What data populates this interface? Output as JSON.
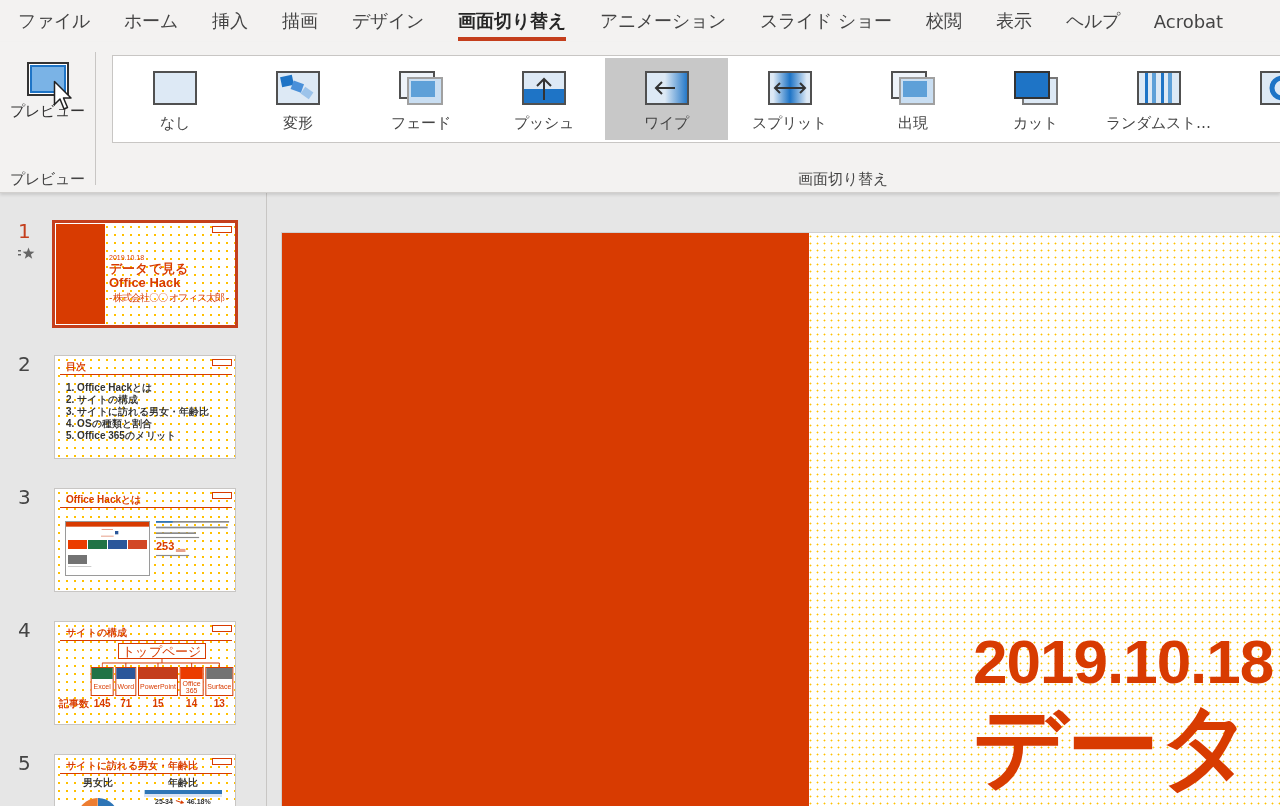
{
  "ribbon_tabs": [
    {
      "label": "ファイル",
      "selected": false
    },
    {
      "label": "ホーム",
      "selected": false
    },
    {
      "label": "挿入",
      "selected": false
    },
    {
      "label": "描画",
      "selected": false
    },
    {
      "label": "デザイン",
      "selected": false
    },
    {
      "label": "画面切り替え",
      "selected": true
    },
    {
      "label": "アニメーション",
      "selected": false
    },
    {
      "label": "スライド ショー",
      "selected": false
    },
    {
      "label": "校閲",
      "selected": false
    },
    {
      "label": "表示",
      "selected": false
    },
    {
      "label": "ヘルプ",
      "selected": false
    },
    {
      "label": "Acrobat",
      "selected": false
    }
  ],
  "ribbon": {
    "preview": {
      "button": "プレビュー",
      "group_label": "プレビュー"
    },
    "transitions": {
      "gallery": [
        {
          "label": "なし",
          "selected": false
        },
        {
          "label": "変形",
          "selected": false
        },
        {
          "label": "フェード",
          "selected": false
        },
        {
          "label": "プッシュ",
          "selected": false
        },
        {
          "label": "ワイプ",
          "selected": true
        },
        {
          "label": "スプリット",
          "selected": false
        },
        {
          "label": "出現",
          "selected": false
        },
        {
          "label": "カット",
          "selected": false
        },
        {
          "label": "ランダムスト…",
          "selected": false
        },
        {
          "selected": false
        }
      ],
      "group_label": "画面切り替え"
    }
  },
  "slides": [
    {
      "number": "1",
      "selected": true,
      "transition": true,
      "kind": "title",
      "date": "2019.10.18",
      "title": "データで見るOffice Hack",
      "subtitle": "- 株式会社〇〇 オフィス太郎 -"
    },
    {
      "number": "2",
      "selected": false,
      "transition": false,
      "kind": "agenda",
      "title": "目次",
      "items": [
        "1. Office Hackとは",
        "2. サイトの構成",
        "3. サイトに訪れる男女・年齢比",
        "4. OSの種類と割合",
        "5. Office 365のメリット"
      ]
    },
    {
      "number": "3",
      "selected": false,
      "transition": false,
      "kind": "about",
      "title": "Office Hackとは",
      "figure": "253"
    },
    {
      "number": "4",
      "selected": false,
      "transition": false,
      "kind": "structure",
      "title": "サイトの構成",
      "root": "トップページ",
      "count_label": "記事数",
      "categories": [
        {
          "name": "Excel",
          "count": "145",
          "color": "#217346"
        },
        {
          "name": "Word",
          "count": "71",
          "color": "#2b579a"
        },
        {
          "name": "PowerPoint",
          "count": "15",
          "color": "#c43e1c"
        },
        {
          "name": "Office 365",
          "count": "14",
          "color": "#eb3c00"
        },
        {
          "name": "Surface",
          "count": "13",
          "color": "#737373"
        }
      ]
    },
    {
      "number": "5",
      "selected": false,
      "transition": false,
      "kind": "demographics",
      "title": "サイトに訪れる男女・年齢比",
      "gender_heading": "男女比",
      "age_heading": "年齢比",
      "age_range": "25-34",
      "share": "46.18%"
    }
  ],
  "main_slide": {
    "date": "2019.10.18",
    "title": "データ"
  }
}
